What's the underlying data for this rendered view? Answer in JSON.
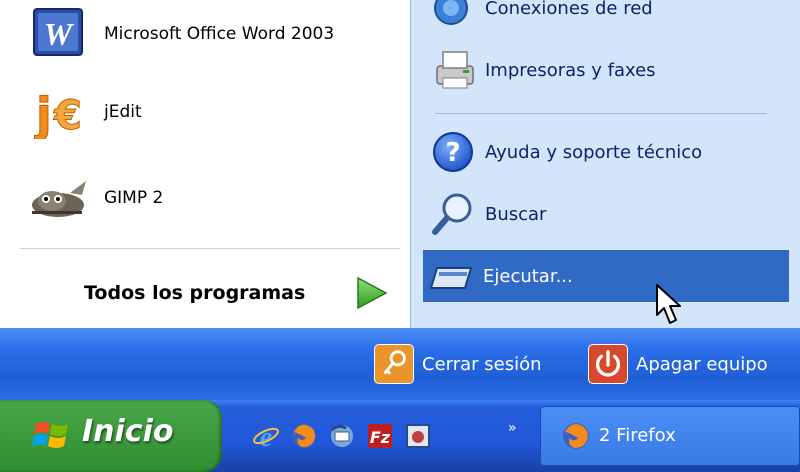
{
  "start_menu": {
    "left": {
      "items": [
        {
          "label": "Microsoft Office Word 2003",
          "icon": "word-icon"
        },
        {
          "label": "jEdit",
          "icon": "jedit-icon"
        },
        {
          "label": "GIMP 2",
          "icon": "gimp-icon"
        }
      ],
      "all_programs": "Todos los programas"
    },
    "right": {
      "items": [
        {
          "label": "Conexiones de red",
          "icon": "network-icon"
        },
        {
          "label": "Impresoras y faxes",
          "icon": "printer-icon"
        },
        {
          "label": "Ayuda y soporte técnico",
          "icon": "help-icon"
        },
        {
          "label": "Buscar",
          "icon": "search-icon"
        },
        {
          "label": "Ejecutar...",
          "icon": "run-icon"
        }
      ]
    },
    "footer": {
      "logoff": "Cerrar sesión",
      "shutdown": "Apagar equipo"
    }
  },
  "taskbar": {
    "start_label": "Inicio",
    "quicklaunch": [
      "ie-icon",
      "firefox-icon",
      "thunderbird-icon",
      "filezilla-icon",
      "app-icon"
    ],
    "chevron": "»",
    "task_button": "2 Firefox"
  },
  "colors": {
    "selection": "#316ac5",
    "right_pane": "#d3e5fa",
    "start_button": "#3c9a3c",
    "taskbar": "#245edb"
  }
}
